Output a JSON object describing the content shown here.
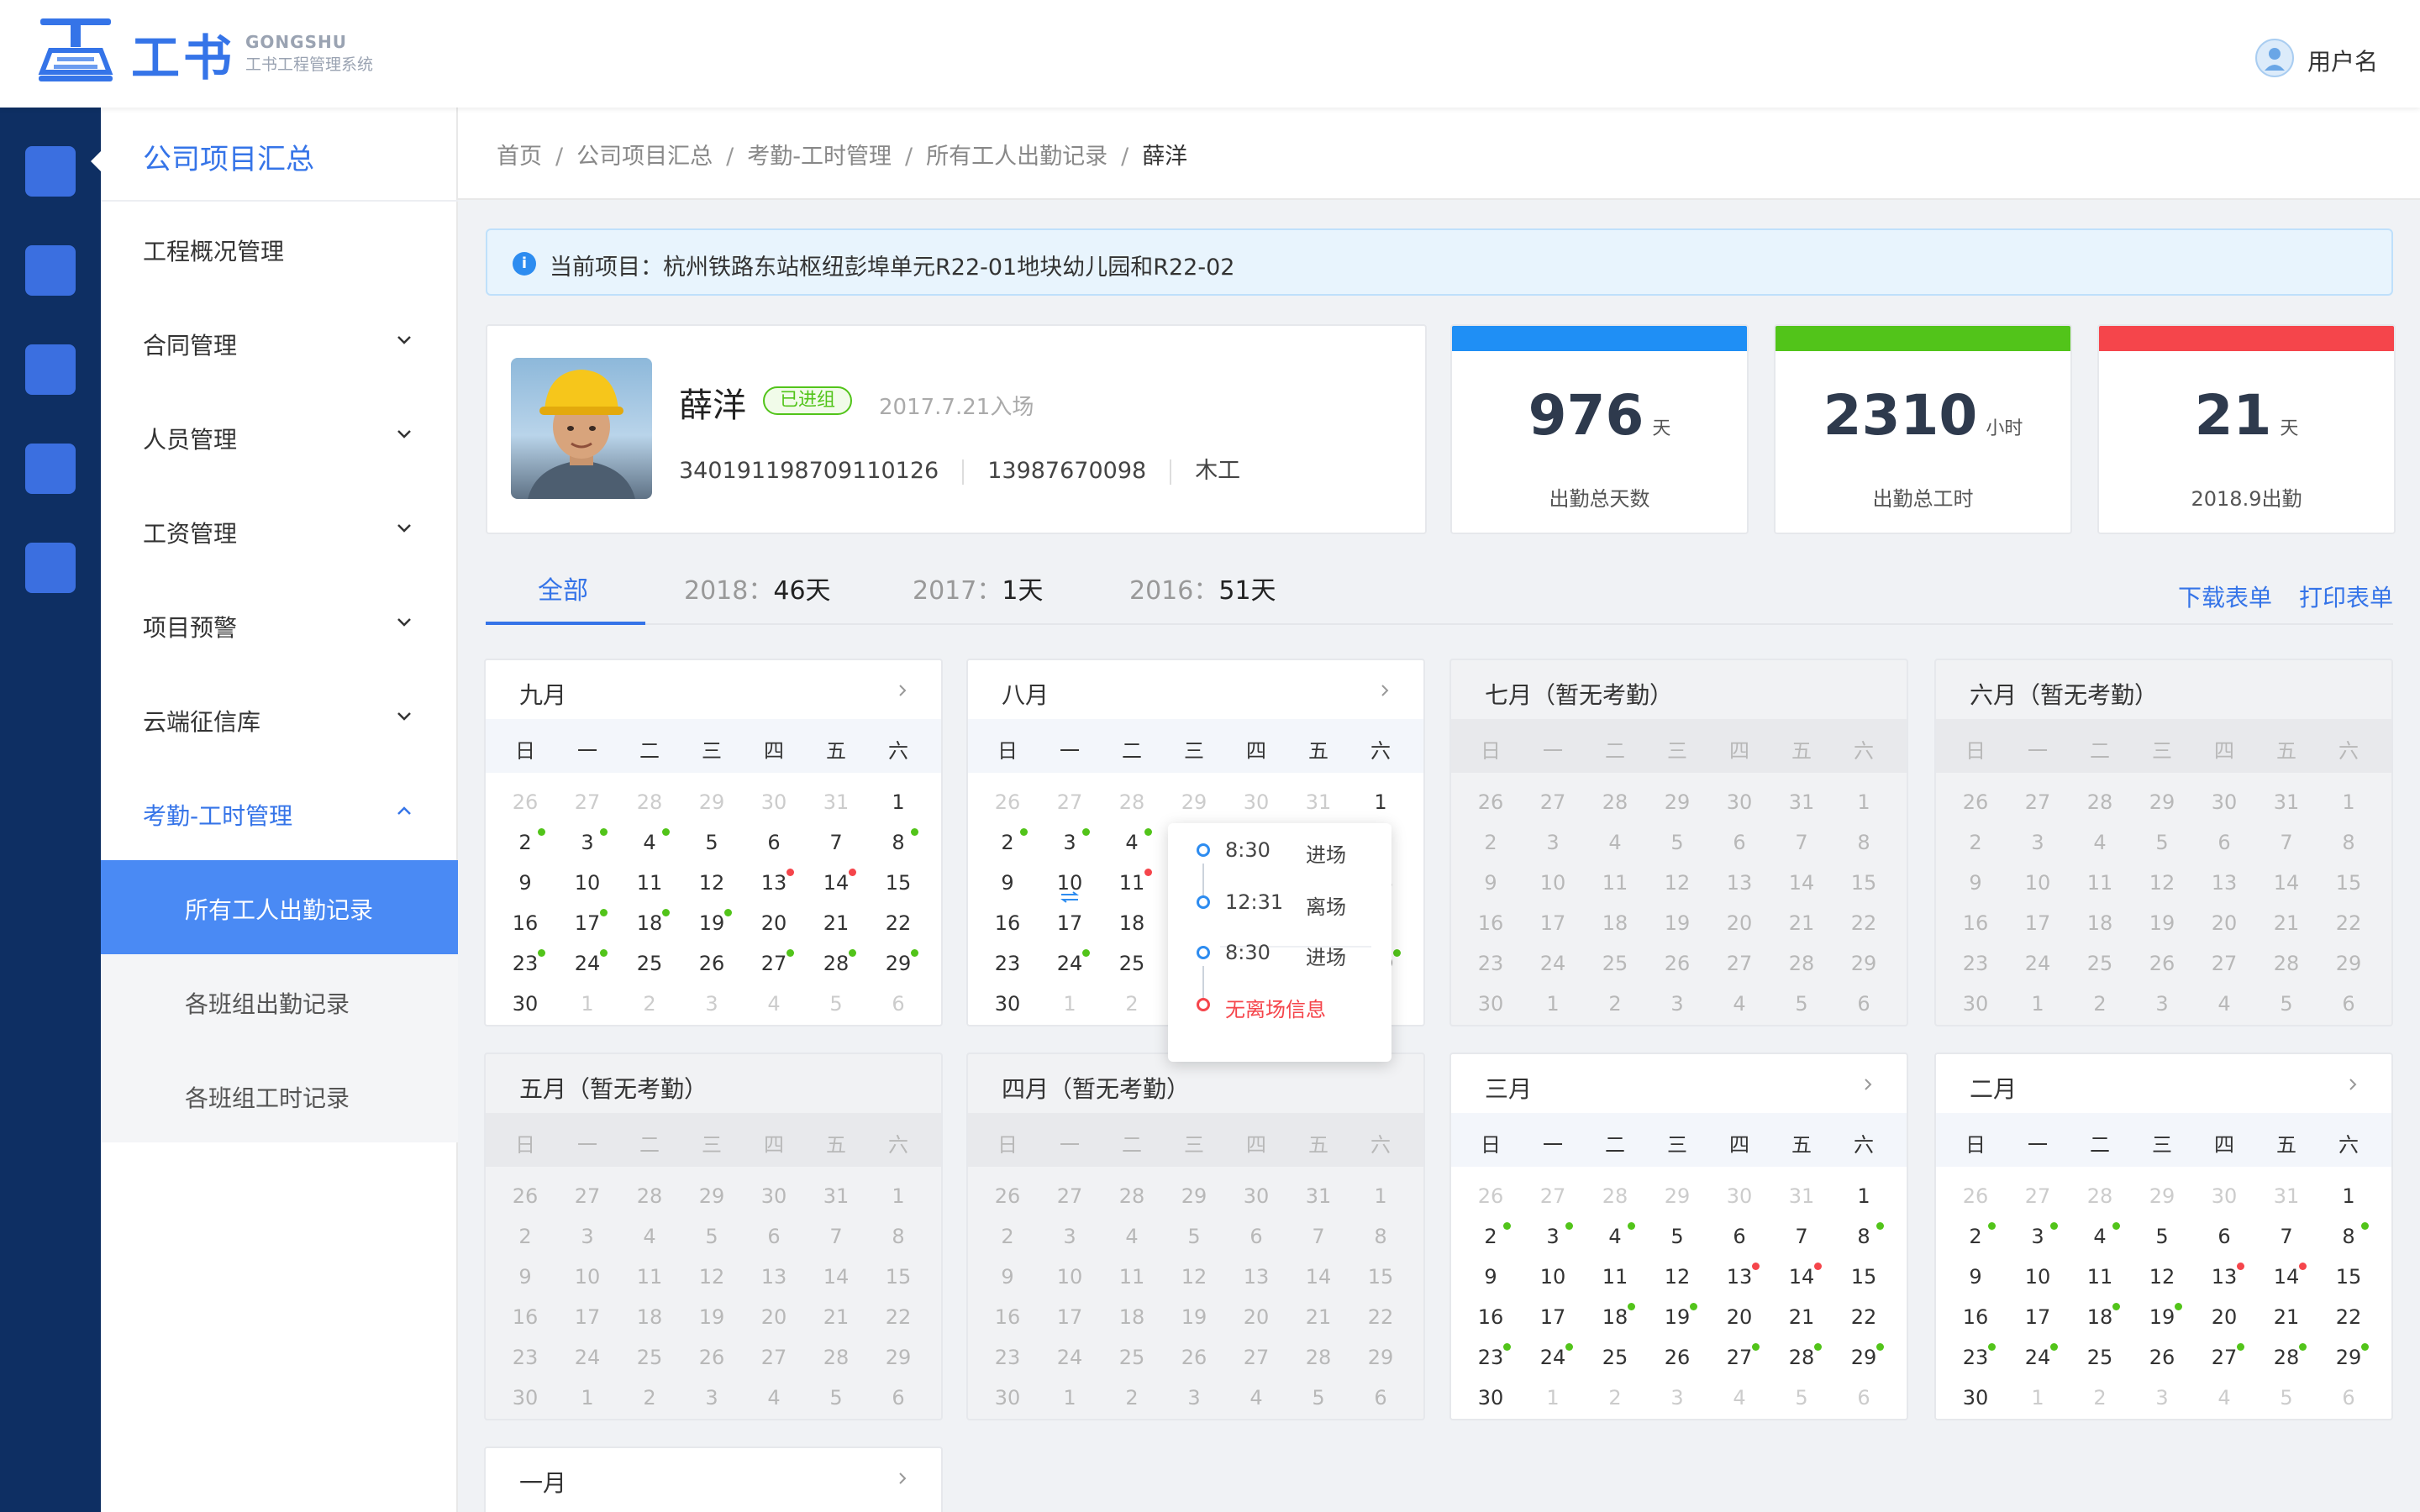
{
  "brand": {
    "cn": "工书",
    "en": "GONGSHU",
    "sub": "工书工程管理系统"
  },
  "user": {
    "name": "用户名"
  },
  "menu": {
    "title": "公司项目汇总",
    "items": [
      {
        "label": "工程概况管理",
        "has_chevron": false
      },
      {
        "label": "合同管理",
        "has_chevron": true
      },
      {
        "label": "人员管理",
        "has_chevron": true
      },
      {
        "label": "工资管理",
        "has_chevron": true
      },
      {
        "label": "项目预警",
        "has_chevron": true
      },
      {
        "label": "云端征信库",
        "has_chevron": true
      },
      {
        "label": "考勤-工时管理",
        "has_chevron": true,
        "expanded": true
      }
    ],
    "sub_items": [
      {
        "label": "所有工人出勤记录",
        "selected": true
      },
      {
        "label": "各班组出勤记录",
        "selected": false
      },
      {
        "label": "各班组工时记录",
        "selected": false
      }
    ]
  },
  "breadcrumb": [
    "首页",
    "公司项目汇总",
    "考勤-工时管理",
    "所有工人出勤记录",
    "薛洋"
  ],
  "alert": {
    "text": "当前项目：杭州铁路东站枢纽彭埠单元R22-01地块幼儿园和R22-02"
  },
  "profile": {
    "name": "薛洋",
    "status": "已进组",
    "entry": "2017.7.21入场",
    "id_number": "340191198709110126",
    "phone": "13987670098",
    "trade": "木工"
  },
  "stats": [
    {
      "value": "976",
      "unit": "天",
      "caption": "出勤总天数",
      "color": "#1f8ff5"
    },
    {
      "value": "2310",
      "unit": "小时",
      "caption": "出勤总工时",
      "color": "#52c41a"
    },
    {
      "value": "21",
      "unit": "天",
      "caption": "2018.9出勤",
      "color": "#f5454b"
    }
  ],
  "tabs": [
    {
      "label": "全部",
      "year": "",
      "value": ""
    },
    {
      "label": "",
      "year": "2018：",
      "value": "46天"
    },
    {
      "label": "",
      "year": "2017：",
      "value": "1天"
    },
    {
      "label": "",
      "year": "2016：",
      "value": "51天"
    }
  ],
  "actions": {
    "download": "下载表单",
    "print": "打印表单"
  },
  "weekdays": [
    "日",
    "一",
    "二",
    "三",
    "四",
    "五",
    "六"
  ],
  "months": [
    {
      "title": "九月",
      "empty": false,
      "has_chevron": true,
      "green": [
        2,
        3,
        4,
        8,
        17,
        18,
        19,
        23,
        24,
        27,
        28,
        29
      ],
      "red": [
        13,
        14
      ]
    },
    {
      "title": "八月",
      "empty": false,
      "has_chevron": true,
      "green": [
        2,
        3,
        4,
        6,
        24,
        29
      ],
      "red": [
        11
      ],
      "transfer": [
        10
      ]
    },
    {
      "title": "七月（暂无考勤）",
      "empty": true,
      "has_chevron": false,
      "green": [],
      "red": []
    },
    {
      "title": "六月（暂无考勤）",
      "empty": true,
      "has_chevron": false,
      "green": [],
      "red": []
    },
    {
      "title": "五月（暂无考勤）",
      "empty": true,
      "has_chevron": false,
      "green": [],
      "red": []
    },
    {
      "title": "四月（暂无考勤）",
      "empty": true,
      "has_chevron": false,
      "green": [],
      "red": []
    },
    {
      "title": "三月",
      "empty": false,
      "has_chevron": true,
      "green": [
        2,
        3,
        4,
        8,
        18,
        19,
        23,
        24,
        27,
        28,
        29
      ],
      "red": [
        13,
        14
      ]
    },
    {
      "title": "二月",
      "empty": false,
      "has_chevron": true,
      "green": [
        2,
        3,
        4,
        8,
        18,
        19,
        23,
        24,
        27,
        28,
        29
      ],
      "red": [
        13,
        14
      ]
    },
    {
      "title": "一月",
      "empty": false,
      "has_chevron": true,
      "green": [],
      "red": []
    }
  ],
  "popup": {
    "entries": [
      {
        "time": "8:30",
        "kind": "进场"
      },
      {
        "time": "12:31",
        "kind": "离场"
      },
      {
        "time": "8:30",
        "kind": "进场"
      }
    ],
    "warning": "无离场信息"
  }
}
